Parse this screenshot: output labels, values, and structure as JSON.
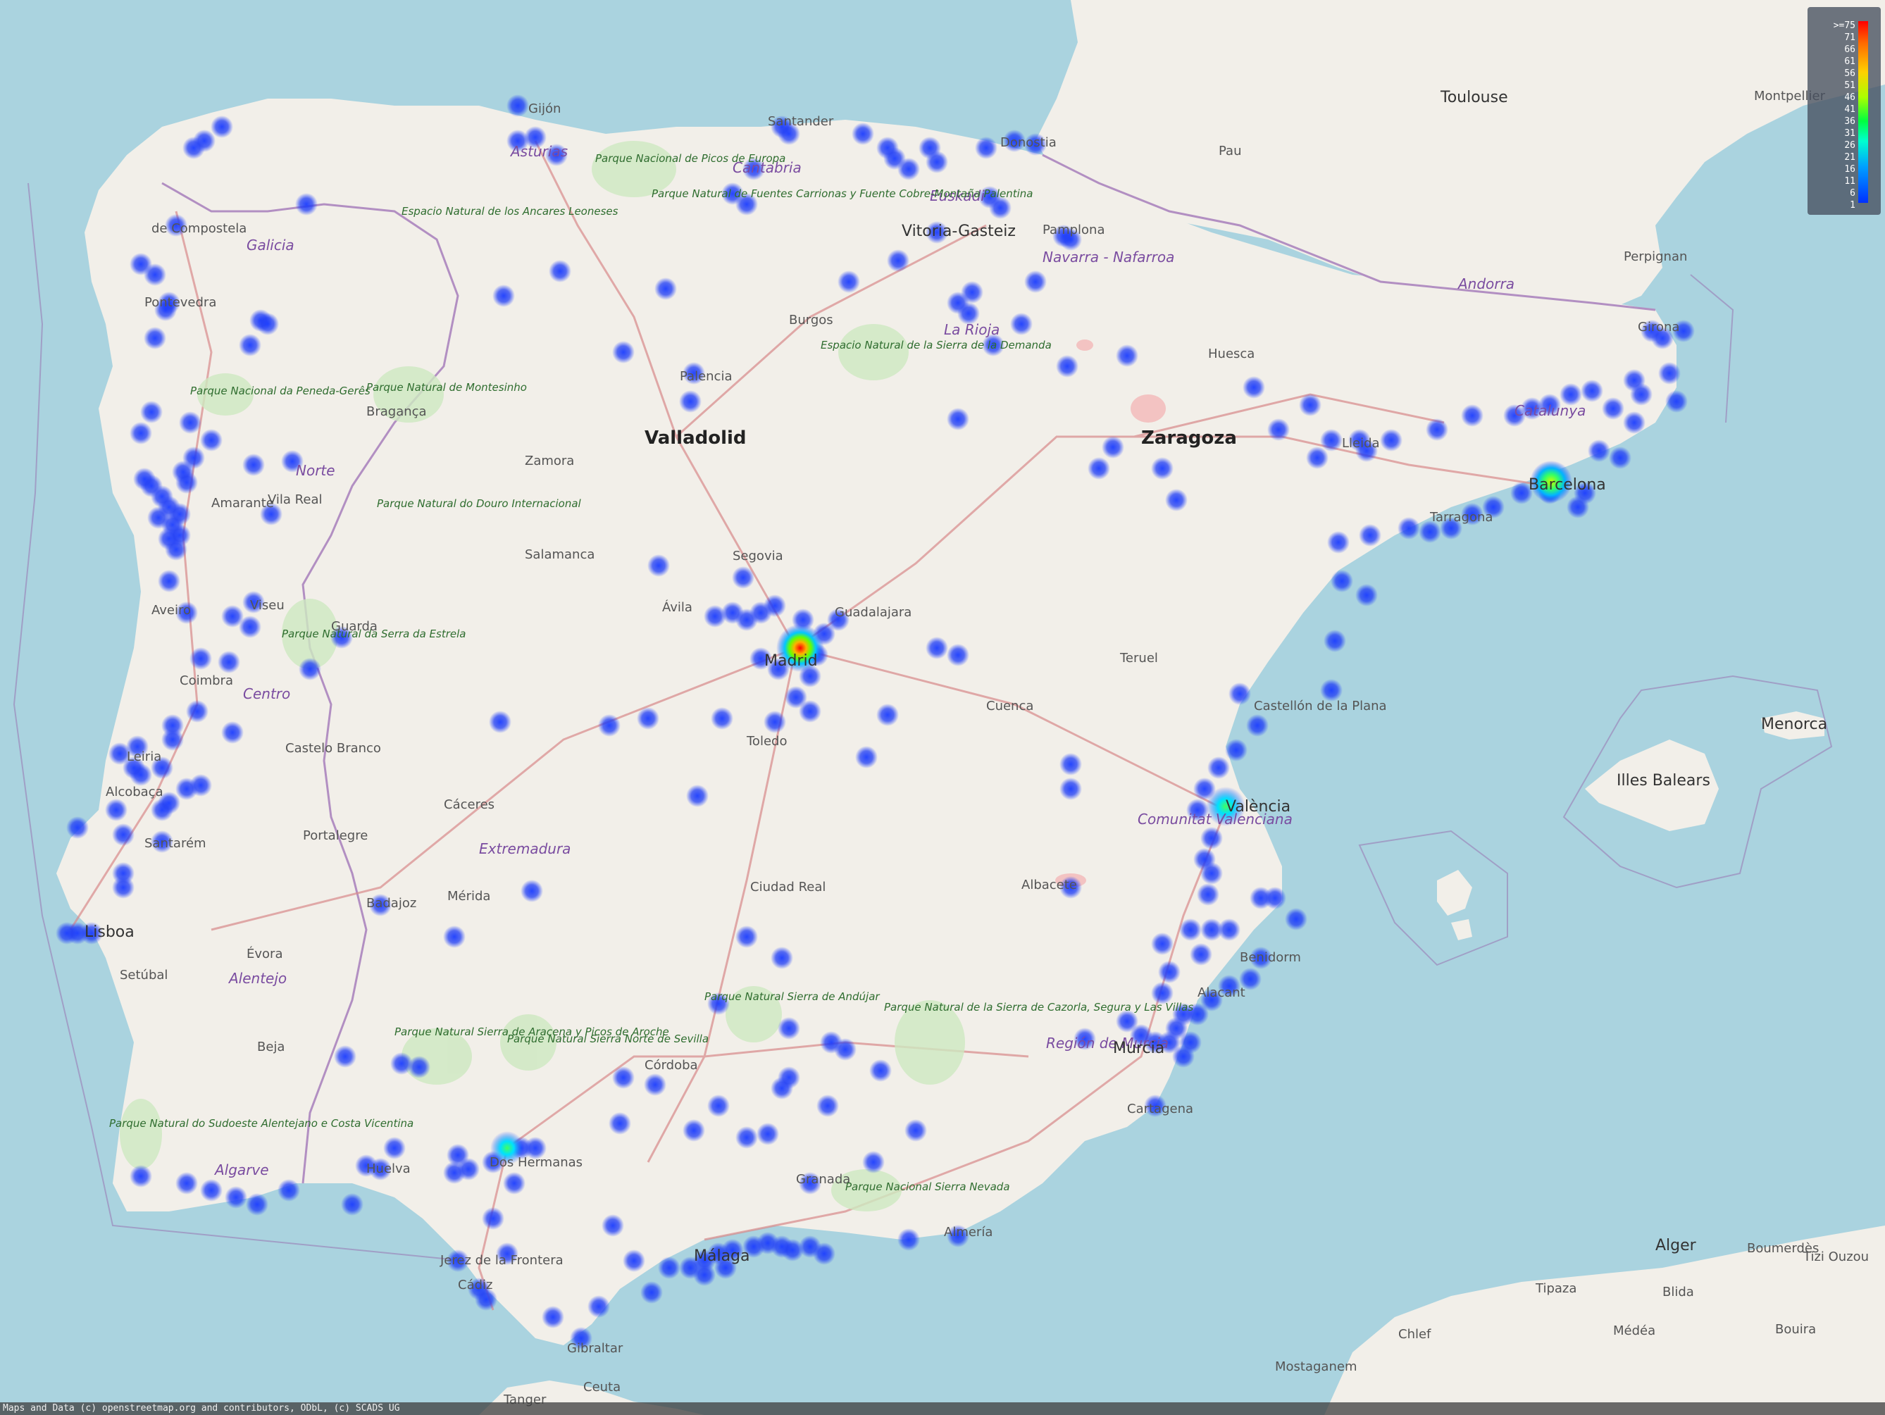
{
  "map": {
    "legend": {
      "ticks": [
        ">=75",
        "71",
        "66",
        "61",
        "56",
        "51",
        "46",
        "41",
        "36",
        "31",
        "26",
        "21",
        "16",
        "11",
        "6",
        "1"
      ],
      "colors": [
        "#ff0000",
        "#ff6a00",
        "#ffd000",
        "#aaff00",
        "#00ff40",
        "#00ffd0",
        "#00a0ff",
        "#0030ff"
      ]
    },
    "attribution": "Maps and Data (c) openstreetmap.org and contributors, ODbL, (c) SCADS UG",
    "cities": {
      "toulouse": "Toulouse",
      "pau": "Pau",
      "montpellier": "Montpellier",
      "perpignan": "Perpignan",
      "andorra": "Andorra",
      "gijon": "Gijón",
      "santander": "Santander",
      "vitoria": "Vitoria-Gasteiz",
      "valladolid": "Valladolid",
      "zaragoza": "Zaragoza",
      "salamanca": "Salamanca",
      "segovia": "Segovia",
      "guadalajara": "Guadalajara",
      "avila": "Ávila",
      "toledo": "Toledo",
      "cuenca": "Cuenca",
      "castellon": "Castellón de la Plana",
      "valencia": "València",
      "albacete": "Albacete",
      "ciudad_real": "Ciudad Real",
      "merida": "Mérida",
      "badajoz": "Badajoz",
      "caceres": "Cáceres",
      "castelo_branco": "Castelo Branco",
      "portalegre": "Portalegre",
      "evora": "Évora",
      "lisboa": "Lisboa",
      "setubal": "Setúbal",
      "beja": "Beja",
      "coimbra": "Coimbra",
      "aveiro": "Aveiro",
      "viseu": "Viseu",
      "guarda": "Guarda",
      "vila_real": "Vila Real",
      "amarante": "Amarante",
      "braganca": "Bragança",
      "zamora": "Zamora",
      "palencia": "Palencia",
      "burgos": "Burgos",
      "santiago": "de Compostela",
      "pontevedra": "Pontevedra",
      "leiria": "Leiria",
      "alcobaca": "Alcobaça",
      "santarem": "Santarém",
      "huelva": "Huelva",
      "dos_hermanas": "Dos Hermanas",
      "jerez": "Jerez de la Frontera",
      "cadiz": "Cádiz",
      "gibraltar": "Gibraltar",
      "malaga": "Málaga",
      "granada": "Granada",
      "almeria": "Almería",
      "cordoba": "Córdoba",
      "murcia": "Murcia",
      "cartagena": "Cartagena",
      "alacant": "Alacant",
      "benidorm": "Benidorm",
      "teruel": "Teruel",
      "huesca": "Huesca",
      "lleida": "Lleida",
      "tarragona": "Tarragona",
      "barcelona": "Barcelona",
      "girona": "Girona",
      "menorca": "Menorca",
      "illes_balears": "Illes Balears",
      "alger": "Alger",
      "chlef": "Chlef",
      "tanger": "Tanger",
      "ceuta": "Ceuta",
      "madrid": "Madrid",
      "pamplona": "Pamplona",
      "donostia": "Donostia",
      "logrono": "La Rioja",
      "mostaganem": "Mostaganem",
      "medea": "Médéa",
      "blida": "Blida",
      "tipaza": "Tipaza",
      "bouira": "Bouira",
      "boumerdes": "Boumerdès",
      "tizi_ouzou": "Tizi Ouzou"
    },
    "regions": {
      "galicia": "Galicia",
      "norte": "Norte",
      "centro": "Centro",
      "alentejo": "Alentejo",
      "algarve": "Algarve",
      "extremadura": "Extremadura",
      "catalunya": "Catalunya",
      "comunitat_valenciana": "Comunitat Valenciana",
      "region_murcia": "Región de Murcia",
      "euskadi": "Euskadi",
      "cantabria": "Cantabria",
      "asturias": "Asturias",
      "navarra": "Navarra - Nafarroa"
    },
    "parks": {
      "picos": "Parque Nacional de Picos de Europa",
      "fuentes_carrionas": "Parque Natural de Fuentes Carrionas y Fuente Cobre-Montaña Palentina",
      "ancares": "Espacio Natural de los Ancares Leoneses",
      "peneda": "Parque Nacional da Peneda-Gerês",
      "montesinho": "Parque Natural de Montesinho",
      "douro": "Parque Natural do Douro Internacional",
      "estrela": "Parque Natural da Serra da Estrela",
      "demanda": "Espacio Natural de la Sierra de la Demanda",
      "andujar": "Parque Natural Sierra de Andújar",
      "cazorla": "Parque Natural de la Sierra de Cazorla, Segura y Las Villas",
      "aracena": "Parque Natural Sierra de Aracena y Picos de Aroche",
      "sierra_norte": "Parque Natural Sierra Norte de Sevilla",
      "sierra_nevada": "Parque Nacional Sierra Nevada",
      "sudoeste": "Parque Natural do Sudoeste Alentejano e Costa Vicentina"
    }
  }
}
